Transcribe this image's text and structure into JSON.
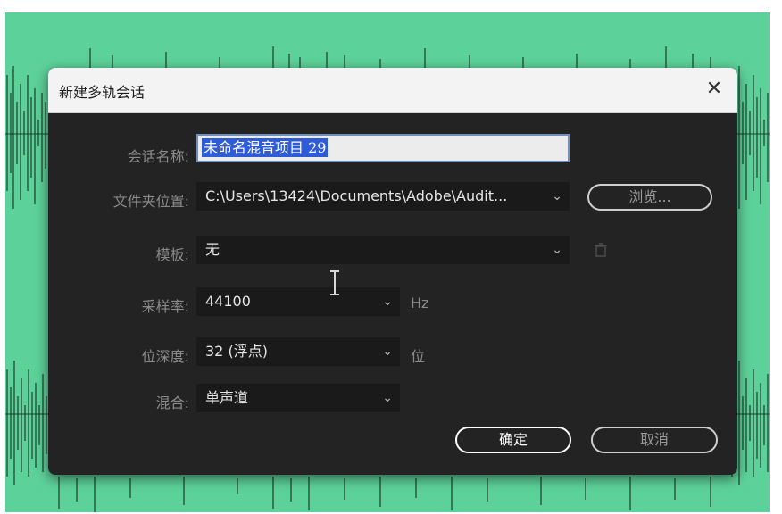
{
  "dialog": {
    "title": "新建多轨会话",
    "close_glyph": "✕",
    "icons": [
      "close-icon",
      "chevron-down-icon",
      "trash-icon",
      "text-cursor-icon"
    ]
  },
  "form": {
    "session_name": {
      "label": "会话名称:",
      "value": "未命名混音项目 29"
    },
    "folder_location": {
      "label": "文件夹位置:",
      "value": "C:\\Users\\13424\\Documents\\Adobe\\Audit...",
      "browse_label": "浏览..."
    },
    "template": {
      "label": "模板:",
      "value": "无"
    },
    "sample_rate": {
      "label": "采样率:",
      "value": "44100",
      "unit": "Hz"
    },
    "bit_depth": {
      "label": "位深度:",
      "value": "32 (浮点)",
      "unit": "位"
    },
    "mix": {
      "label": "混合:",
      "value": "单声道"
    }
  },
  "buttons": {
    "ok": "确定",
    "cancel": "取消"
  },
  "colors": {
    "background_wave": "#5dd19a",
    "dialog_bg": "#232323",
    "selection": "#2e5bd6"
  }
}
